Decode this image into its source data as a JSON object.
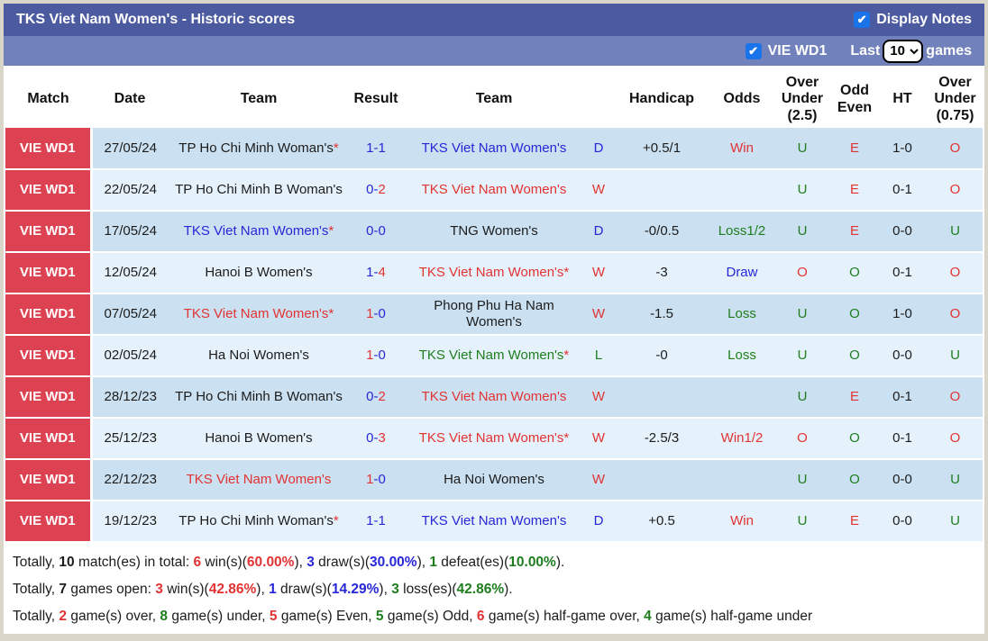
{
  "header_bar": {
    "title": "TKS Viet Nam Women's - Historic scores",
    "display_notes_label": "Display Notes",
    "display_notes_checked": true
  },
  "filter_bar": {
    "league_label": "VIE WD1",
    "league_checked": true,
    "last_label": "Last",
    "games_count": "10",
    "games_label": "games"
  },
  "colors": {
    "red": "#e23333",
    "blue": "#2727d8",
    "green": "#1e7e1e",
    "black": "#1c1c1c",
    "title_bar": "#4c5ba0",
    "filter_bar": "#7181bb",
    "league_cell": "#dc4251",
    "row_dark": "#cbe0f1",
    "row_light": "#e6f2fb",
    "checkbox_blue": "#1a73e8"
  },
  "table": {
    "columns": [
      "Match",
      "Date",
      "Team",
      "Result",
      "Team",
      "",
      "Handicap",
      "Odds",
      "Over Under (2.5)",
      "Odd Even",
      "HT",
      "Over Under (0.75)"
    ],
    "rows": [
      {
        "match": "VIE WD1",
        "date": "27/05/24",
        "team1": {
          "name": "TP Ho Chi Minh Woman's",
          "star": true,
          "color": "black"
        },
        "result": {
          "home": "1",
          "away": "1",
          "home_color": "blue",
          "away_color": "blue"
        },
        "team2": {
          "name": "TKS Viet Nam Women's",
          "star": false,
          "color": "blue"
        },
        "wdl": {
          "text": "D",
          "color": "blue"
        },
        "handicap": "+0.5/1",
        "odds": {
          "text": "Win",
          "color": "red"
        },
        "ou25": {
          "text": "U",
          "color": "green"
        },
        "odd_even": {
          "text": "E",
          "color": "red"
        },
        "ht": "1-0",
        "ou075": {
          "text": "O",
          "color": "red"
        }
      },
      {
        "match": "VIE WD1",
        "date": "22/05/24",
        "team1": {
          "name": "TP Ho Chi Minh B Woman's",
          "star": false,
          "color": "black"
        },
        "result": {
          "home": "0",
          "away": "2",
          "home_color": "blue",
          "away_color": "red"
        },
        "team2": {
          "name": "TKS Viet Nam Women's",
          "star": false,
          "color": "red"
        },
        "wdl": {
          "text": "W",
          "color": "red"
        },
        "handicap": "",
        "odds": {
          "text": "",
          "color": "black"
        },
        "ou25": {
          "text": "U",
          "color": "green"
        },
        "odd_even": {
          "text": "E",
          "color": "red"
        },
        "ht": "0-1",
        "ou075": {
          "text": "O",
          "color": "red"
        }
      },
      {
        "match": "VIE WD1",
        "date": "17/05/24",
        "team1": {
          "name": "TKS Viet Nam Women's",
          "star": true,
          "color": "blue"
        },
        "result": {
          "home": "0",
          "away": "0",
          "home_color": "blue",
          "away_color": "blue"
        },
        "team2": {
          "name": "TNG Women's",
          "star": false,
          "color": "black"
        },
        "wdl": {
          "text": "D",
          "color": "blue"
        },
        "handicap": "-0/0.5",
        "odds": {
          "text": "Loss1/2",
          "color": "green"
        },
        "ou25": {
          "text": "U",
          "color": "green"
        },
        "odd_even": {
          "text": "E",
          "color": "red"
        },
        "ht": "0-0",
        "ou075": {
          "text": "U",
          "color": "green"
        }
      },
      {
        "match": "VIE WD1",
        "date": "12/05/24",
        "team1": {
          "name": "Hanoi B Women's",
          "star": false,
          "color": "black"
        },
        "result": {
          "home": "1",
          "away": "4",
          "home_color": "blue",
          "away_color": "red"
        },
        "team2": {
          "name": "TKS Viet Nam Women's",
          "star": true,
          "color": "red"
        },
        "wdl": {
          "text": "W",
          "color": "red"
        },
        "handicap": "-3",
        "odds": {
          "text": "Draw",
          "color": "blue"
        },
        "ou25": {
          "text": "O",
          "color": "red"
        },
        "odd_even": {
          "text": "O",
          "color": "green"
        },
        "ht": "0-1",
        "ou075": {
          "text": "O",
          "color": "red"
        }
      },
      {
        "match": "VIE WD1",
        "date": "07/05/24",
        "team1": {
          "name": "TKS Viet Nam Women's",
          "star": true,
          "color": "red"
        },
        "result": {
          "home": "1",
          "away": "0",
          "home_color": "red",
          "away_color": "blue"
        },
        "team2": {
          "name": "Phong Phu Ha Nam Women's",
          "star": false,
          "color": "black"
        },
        "wdl": {
          "text": "W",
          "color": "red"
        },
        "handicap": "-1.5",
        "odds": {
          "text": "Loss",
          "color": "green"
        },
        "ou25": {
          "text": "U",
          "color": "green"
        },
        "odd_even": {
          "text": "O",
          "color": "green"
        },
        "ht": "1-0",
        "ou075": {
          "text": "O",
          "color": "red"
        }
      },
      {
        "match": "VIE WD1",
        "date": "02/05/24",
        "team1": {
          "name": "Ha Noi Women's",
          "star": false,
          "color": "black"
        },
        "result": {
          "home": "1",
          "away": "0",
          "home_color": "red",
          "away_color": "blue"
        },
        "team2": {
          "name": "TKS Viet Nam Women's",
          "star": true,
          "color": "green"
        },
        "wdl": {
          "text": "L",
          "color": "green"
        },
        "handicap": "-0",
        "odds": {
          "text": "Loss",
          "color": "green"
        },
        "ou25": {
          "text": "U",
          "color": "green"
        },
        "odd_even": {
          "text": "O",
          "color": "green"
        },
        "ht": "0-0",
        "ou075": {
          "text": "U",
          "color": "green"
        }
      },
      {
        "match": "VIE WD1",
        "date": "28/12/23",
        "team1": {
          "name": "TP Ho Chi Minh B Woman's",
          "star": false,
          "color": "black"
        },
        "result": {
          "home": "0",
          "away": "2",
          "home_color": "blue",
          "away_color": "red"
        },
        "team2": {
          "name": "TKS Viet Nam Women's",
          "star": false,
          "color": "red"
        },
        "wdl": {
          "text": "W",
          "color": "red"
        },
        "handicap": "",
        "odds": {
          "text": "",
          "color": "black"
        },
        "ou25": {
          "text": "U",
          "color": "green"
        },
        "odd_even": {
          "text": "E",
          "color": "red"
        },
        "ht": "0-1",
        "ou075": {
          "text": "O",
          "color": "red"
        }
      },
      {
        "match": "VIE WD1",
        "date": "25/12/23",
        "team1": {
          "name": "Hanoi B Women's",
          "star": false,
          "color": "black"
        },
        "result": {
          "home": "0",
          "away": "3",
          "home_color": "blue",
          "away_color": "red"
        },
        "team2": {
          "name": "TKS Viet Nam Women's",
          "star": true,
          "color": "red"
        },
        "wdl": {
          "text": "W",
          "color": "red"
        },
        "handicap": "-2.5/3",
        "odds": {
          "text": "Win1/2",
          "color": "red"
        },
        "ou25": {
          "text": "O",
          "color": "red"
        },
        "odd_even": {
          "text": "O",
          "color": "green"
        },
        "ht": "0-1",
        "ou075": {
          "text": "O",
          "color": "red"
        }
      },
      {
        "match": "VIE WD1",
        "date": "22/12/23",
        "team1": {
          "name": "TKS Viet Nam Women's",
          "star": false,
          "color": "red"
        },
        "result": {
          "home": "1",
          "away": "0",
          "home_color": "red",
          "away_color": "blue"
        },
        "team2": {
          "name": "Ha Noi Women's",
          "star": false,
          "color": "black"
        },
        "wdl": {
          "text": "W",
          "color": "red"
        },
        "handicap": "",
        "odds": {
          "text": "",
          "color": "black"
        },
        "ou25": {
          "text": "U",
          "color": "green"
        },
        "odd_even": {
          "text": "O",
          "color": "green"
        },
        "ht": "0-0",
        "ou075": {
          "text": "U",
          "color": "green"
        }
      },
      {
        "match": "VIE WD1",
        "date": "19/12/23",
        "team1": {
          "name": "TP Ho Chi Minh Woman's",
          "star": true,
          "color": "black"
        },
        "result": {
          "home": "1",
          "away": "1",
          "home_color": "blue",
          "away_color": "blue"
        },
        "team2": {
          "name": "TKS Viet Nam Women's",
          "star": false,
          "color": "blue"
        },
        "wdl": {
          "text": "D",
          "color": "blue"
        },
        "handicap": "+0.5",
        "odds": {
          "text": "Win",
          "color": "red"
        },
        "ou25": {
          "text": "U",
          "color": "green"
        },
        "odd_even": {
          "text": "E",
          "color": "red"
        },
        "ht": "0-0",
        "ou075": {
          "text": "U",
          "color": "green"
        }
      }
    ]
  },
  "summary": {
    "lines": [
      {
        "segments": [
          {
            "text": "Totally, "
          },
          {
            "text": "10",
            "bold": true
          },
          {
            "text": " match(es) in total: "
          },
          {
            "text": "6",
            "bold": true,
            "color": "red"
          },
          {
            "text": " win(s)("
          },
          {
            "text": "60.00%",
            "bold": true,
            "color": "red"
          },
          {
            "text": "), "
          },
          {
            "text": "3",
            "bold": true,
            "color": "blue"
          },
          {
            "text": " draw(s)("
          },
          {
            "text": "30.00%",
            "bold": true,
            "color": "blue"
          },
          {
            "text": "), "
          },
          {
            "text": "1",
            "bold": true,
            "color": "green"
          },
          {
            "text": " defeat(es)("
          },
          {
            "text": "10.00%",
            "bold": true,
            "color": "green"
          },
          {
            "text": ")."
          }
        ]
      },
      {
        "segments": [
          {
            "text": "Totally, "
          },
          {
            "text": "7",
            "bold": true
          },
          {
            "text": " games open: "
          },
          {
            "text": "3",
            "bold": true,
            "color": "red"
          },
          {
            "text": " win(s)("
          },
          {
            "text": "42.86%",
            "bold": true,
            "color": "red"
          },
          {
            "text": "), "
          },
          {
            "text": "1",
            "bold": true,
            "color": "blue"
          },
          {
            "text": " draw(s)("
          },
          {
            "text": "14.29%",
            "bold": true,
            "color": "blue"
          },
          {
            "text": "), "
          },
          {
            "text": "3",
            "bold": true,
            "color": "green"
          },
          {
            "text": " loss(es)("
          },
          {
            "text": "42.86%",
            "bold": true,
            "color": "green"
          },
          {
            "text": ")."
          }
        ]
      },
      {
        "segments": [
          {
            "text": "Totally, "
          },
          {
            "text": "2",
            "bold": true,
            "color": "red"
          },
          {
            "text": " game(s) over, "
          },
          {
            "text": "8",
            "bold": true,
            "color": "green"
          },
          {
            "text": " game(s) under, "
          },
          {
            "text": "5",
            "bold": true,
            "color": "red"
          },
          {
            "text": " game(s) Even, "
          },
          {
            "text": "5",
            "bold": true,
            "color": "green"
          },
          {
            "text": " game(s) Odd, "
          },
          {
            "text": "6",
            "bold": true,
            "color": "red"
          },
          {
            "text": " game(s) half-game over, "
          },
          {
            "text": "4",
            "bold": true,
            "color": "green"
          },
          {
            "text": " game(s) half-game under"
          }
        ]
      }
    ]
  }
}
